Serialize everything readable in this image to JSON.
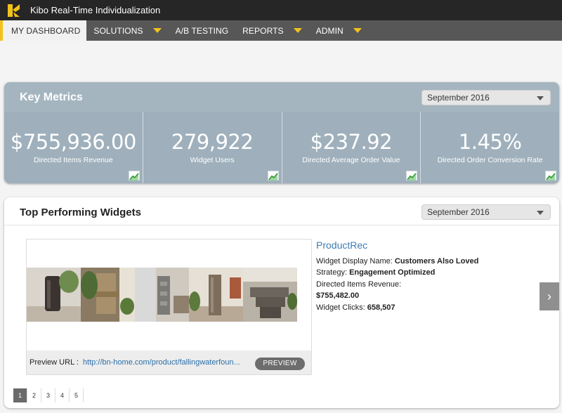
{
  "app": {
    "title": "Kibo Real-Time Individualization"
  },
  "nav": {
    "items": [
      {
        "label": "MY DASHBOARD",
        "has_menu": false
      },
      {
        "label": "SOLUTIONS",
        "has_menu": true
      },
      {
        "label": "A/B TESTING",
        "has_menu": false
      },
      {
        "label": "REPORTS",
        "has_menu": true
      },
      {
        "label": "ADMIN",
        "has_menu": true
      }
    ],
    "active": "MY DASHBOARD"
  },
  "key_metrics": {
    "title": "Key Metrics",
    "period": "September 2016",
    "cards": [
      {
        "value": "$755,936.00",
        "label": "Directed Items Revenue"
      },
      {
        "value": "279,922",
        "label": "Widget Users"
      },
      {
        "value": "$237.92",
        "label": "Directed Average Order Value"
      },
      {
        "value": "1.45%",
        "label": "Directed Order Conversion Rate"
      }
    ]
  },
  "top_widgets": {
    "title": "Top Performing Widgets",
    "period": "September 2016",
    "widget": {
      "name": "ProductRec",
      "display_name_label": "Widget Display Name:",
      "display_name": "Customers Also Loved",
      "strategy_label": "Strategy:",
      "strategy": "Engagement Optimized",
      "revenue_label": "Directed Items Revenue:",
      "revenue": "$755,482.00",
      "clicks_label": "Widget Clicks:",
      "clicks": "658,507",
      "preview_label": "Preview URL :",
      "preview_url": "http://bn-home.com/product/fallingwaterfoun...",
      "preview_button": "PREVIEW"
    },
    "pages": [
      "1",
      "2",
      "3",
      "4",
      "5"
    ],
    "active_page": "1"
  },
  "colors": {
    "accent": "#f2c21b",
    "metrics_bg": "#a5b5c0",
    "link": "#3f7cb2"
  }
}
